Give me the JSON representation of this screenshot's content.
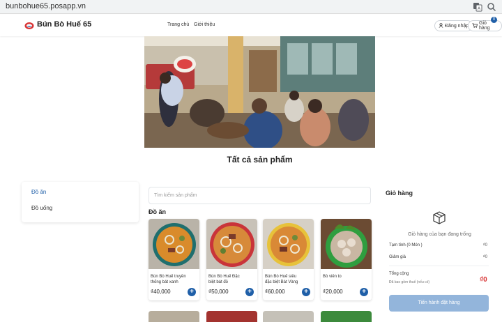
{
  "browser": {
    "url": "bunbohue65.posapp.vn"
  },
  "header": {
    "brand": "Bún Bò Huế 65",
    "nav": [
      "Trang chủ",
      "Giới thiệu"
    ],
    "login_label": "Đăng nhập",
    "cart_label": "Giỏ hàng",
    "cart_count": "0"
  },
  "main": {
    "title": "Tất cả sản phẩm",
    "categories": [
      {
        "label": "Đồ ăn",
        "active": true
      },
      {
        "label": "Đồ uống",
        "active": false
      }
    ],
    "search_placeholder": "Tìm kiếm sản phẩm",
    "group_title": "Đồ ăn",
    "products": [
      {
        "name": "Bún Bò Huế truyền thống bát xanh",
        "price": "₫40,000"
      },
      {
        "name": "Bún Bò Huế Đặc biệt bát đỏ",
        "price": "₫50,000"
      },
      {
        "name": "Bún Bò Huế siêu đặc biệt Bát Vàng",
        "price": "₫60,000"
      },
      {
        "name": "Bò viên to",
        "price": "₫20,000"
      }
    ]
  },
  "cart": {
    "title": "Giỏ hàng",
    "empty_text": "Giỏ hàng của bạn đang trống",
    "subtotal_label": "Tạm tính (0 Món )",
    "subtotal_value": "₫0",
    "discount_label": "Giảm giá",
    "discount_value": "₫0",
    "total_label": "Tổng cộng",
    "tax_note": "Đã bao gồm thuế (nếu có)",
    "total_value": "₫0",
    "checkout_label": "Tiến hành đặt hàng"
  },
  "colors": {
    "accent": "#1f5fa8",
    "total": "#d83434",
    "checkout_disabled": "#93b5db"
  }
}
